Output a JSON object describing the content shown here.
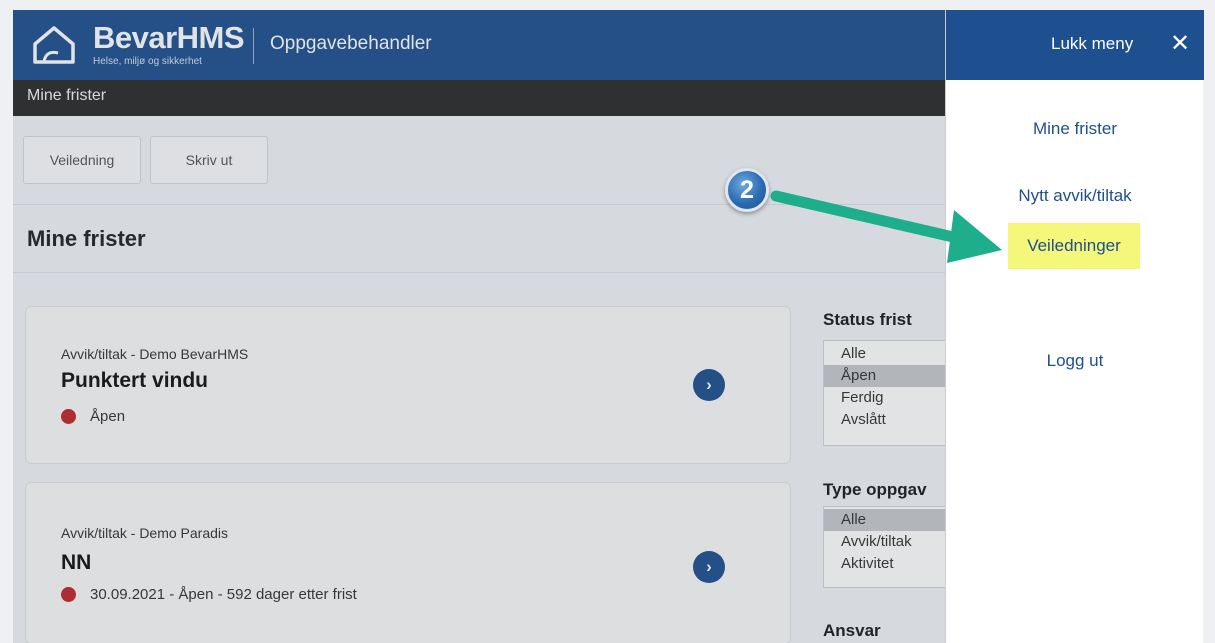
{
  "header": {
    "brand": "BevarHMS",
    "tagline": "Helse, miljø og sikkerhet",
    "app_name": "Oppgavebehandler",
    "logo_icon": "house-logo-icon"
  },
  "subbar": {
    "title": "Mine frister"
  },
  "toolbar": {
    "guide_label": "Veiledning",
    "print_label": "Skriv ut"
  },
  "page": {
    "heading": "Mine frister"
  },
  "cards": [
    {
      "source": "Avvik/tiltak - Demo BevarHMS",
      "title": "Punktert vindu",
      "status": "Åpen",
      "status_color": "#c0272d",
      "action_icon": "chevron-right-icon"
    },
    {
      "source": "Avvik/tiltak - Demo Paradis",
      "title": "NN",
      "status": "30.09.2021 - Åpen - 592 dager etter frist",
      "status_color": "#c0272d",
      "action_icon": "chevron-right-icon"
    }
  ],
  "filters": {
    "status": {
      "label": "Status frist",
      "options": [
        "Alle",
        "Åpen",
        "Ferdig",
        "Avslått"
      ],
      "selected": "Åpen"
    },
    "type": {
      "label": "Type oppgav",
      "options": [
        "Alle",
        "Avvik/tiltak",
        "Aktivitet"
      ],
      "selected": "Alle"
    },
    "ansvar": {
      "label": "Ansvar"
    }
  },
  "side_menu": {
    "close_label": "Lukk meny",
    "close_icon": "close-icon",
    "items": [
      "Mine frister",
      "Nytt avvik/tiltak",
      "Veiledninger",
      "Logg ut"
    ],
    "highlighted": "Veiledninger",
    "highlight_color": "#f4f77a"
  },
  "annotation": {
    "step_number": "2",
    "arrow_color": "#1fae8c"
  },
  "colors": {
    "brand_blue": "#1e4f8f",
    "subbar": "#2a2a2a",
    "status_red": "#c0272d"
  }
}
